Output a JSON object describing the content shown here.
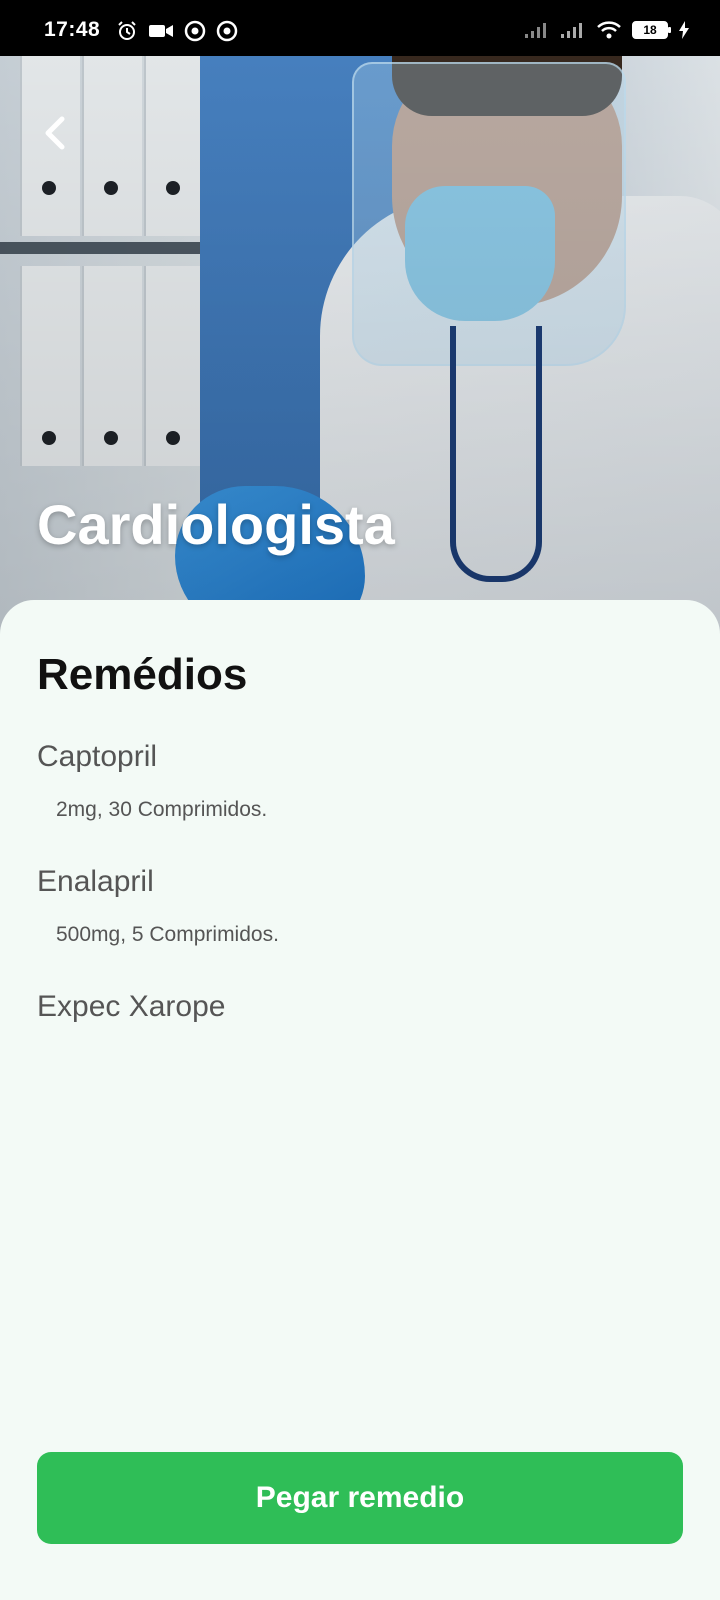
{
  "status_bar": {
    "time": "17:48",
    "battery": "18"
  },
  "header": {
    "title": "Cardiologista",
    "back_icon": "chevron-left-icon"
  },
  "section": {
    "title": "Remédios"
  },
  "medicines": [
    {
      "name": "Captopril",
      "detail": "2mg, 30 Comprimidos."
    },
    {
      "name": "Enalapril",
      "detail": "500mg, 5 Comprimidos."
    },
    {
      "name": "Expec Xarope",
      "detail": ""
    }
  ],
  "cta": {
    "label": "Pegar remedio"
  },
  "colors": {
    "accent": "#2fbe57",
    "background": "#f3faf6",
    "title_text": "#111111",
    "body_text": "#555555"
  }
}
